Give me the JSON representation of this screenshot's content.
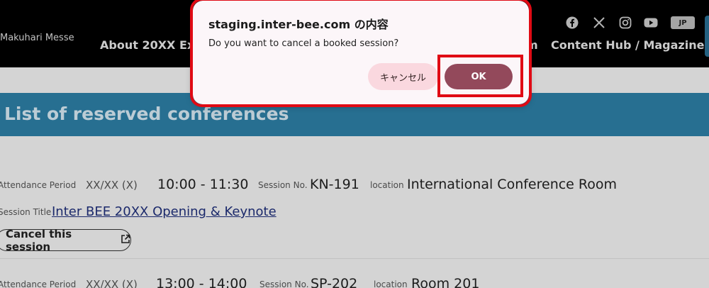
{
  "header": {
    "venue": "Makuhari Messe",
    "nav": {
      "about": "About 20XX",
      "ex": "Ex",
      "m": "m",
      "content_hub": "Content Hub / Magazine"
    },
    "social_icons": [
      "facebook-icon",
      "x-icon",
      "instagram-icon",
      "youtube-icon"
    ],
    "language": "JP"
  },
  "page": {
    "title": "List of reserved conferences"
  },
  "labels": {
    "attendance_period": "Attendance Period",
    "session_no": "Session No.",
    "location": "location",
    "session_title": "Session Title",
    "cancel_button": "Cancel this session"
  },
  "sessions": [
    {
      "date": "XX/XX (X)",
      "time": "10:00 - 11:30",
      "session_no": "KN-191",
      "location": "International Conference Room",
      "title": "Inter BEE 20XX Opening & Keynote"
    },
    {
      "date": "XX/XX (X)",
      "time": "13:00 - 14:00",
      "session_no": "SP-202",
      "location": "Room 201"
    }
  ],
  "dialog": {
    "title": "staging.inter-bee.com の内容",
    "message": "Do you want to cancel a booked session?",
    "cancel_label": "キャンセル",
    "ok_label": "OK"
  },
  "colors": {
    "header_bg": "#000000",
    "banner_bg": "#2d7fa6",
    "ok_button": "#93495b",
    "cancel_button": "#fad8df",
    "highlight": "#e00a14"
  }
}
